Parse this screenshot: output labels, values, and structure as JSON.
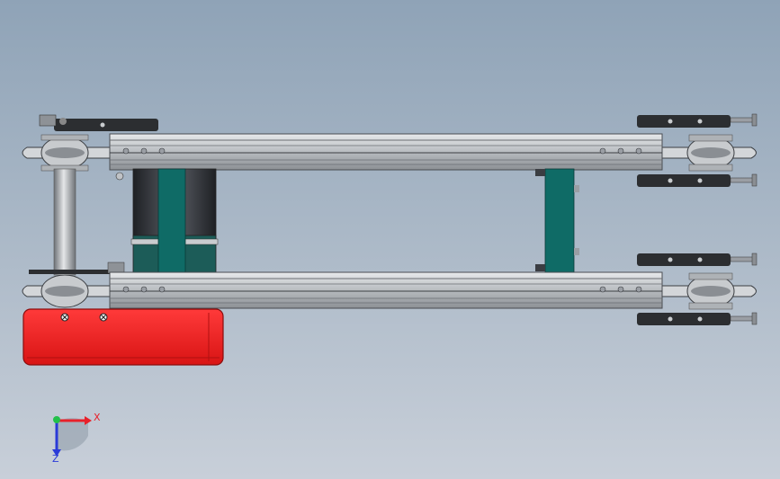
{
  "triad": {
    "x_label": "X",
    "z_label": "Z",
    "x_color": "#e8202a",
    "z_color": "#2a3ad8",
    "y_color": "#22c04a"
  },
  "colors": {
    "motor_housing": "#e81c1c",
    "motor_housing_dark": "#a80e0e",
    "teal_bracket": "#0f6b66",
    "rail_silver": "#c9cccf",
    "rail_edge": "#4a4d52",
    "roller_steel": "#9a9ea4",
    "dark_bracket": "#2c2e31",
    "motor_body": "#3a3d42"
  }
}
